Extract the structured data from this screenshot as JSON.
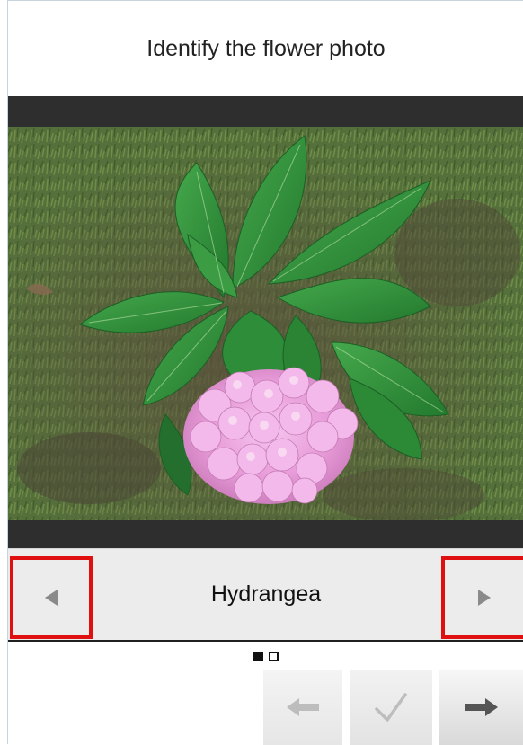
{
  "prompt": {
    "title": "Identify the flower photo"
  },
  "photo": {
    "alt": "Hydrangea",
    "colors": {
      "band": "#2e2e2e",
      "grass": "#56703d",
      "leaf": "#2f8f3a",
      "bloom": "#e9a6de"
    }
  },
  "answer": {
    "label": "Hydrangea",
    "prev_icon": "triangle-left-icon",
    "next_icon": "triangle-right-icon",
    "highlight_color": "#e01010"
  },
  "pager": {
    "pages": 2,
    "current": 1
  },
  "footer": {
    "back_icon": "arrow-left-icon",
    "confirm_icon": "checkmark-icon",
    "forward_icon": "arrow-right-icon"
  }
}
